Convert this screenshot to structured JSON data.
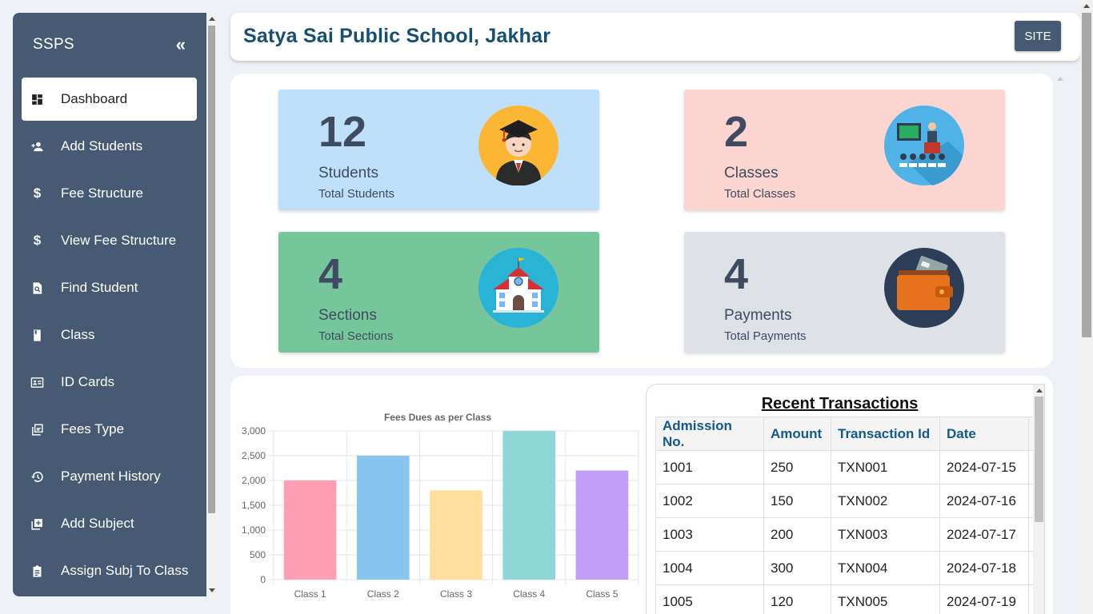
{
  "sidebar": {
    "brand": "SSPS",
    "collapse_icon": "double-chevron-left-icon",
    "items": [
      {
        "label": "Dashboard",
        "icon": "dashboard-icon",
        "active": true
      },
      {
        "label": "Add Students",
        "icon": "person-add-icon"
      },
      {
        "label": "Fee Structure",
        "icon": "dollar-icon"
      },
      {
        "label": "View Fee Structure",
        "icon": "dollar-icon"
      },
      {
        "label": "Find Student",
        "icon": "document-search-icon"
      },
      {
        "label": "Class",
        "icon": "book-icon"
      },
      {
        "label": "ID Cards",
        "icon": "id-card-icon"
      },
      {
        "label": "Fees Type",
        "icon": "library-add-icon"
      },
      {
        "label": "Payment History",
        "icon": "history-icon"
      },
      {
        "label": "Add Subject",
        "icon": "add-box-icon"
      },
      {
        "label": "Assign Subj To Class",
        "icon": "clipboard-icon"
      }
    ]
  },
  "header": {
    "school_name": "Satya Sai Public School, Jakhar",
    "site_label": "SITE"
  },
  "stats": [
    {
      "value": "12",
      "label": "Students",
      "sub": "Total Students",
      "icon": "graduate-icon",
      "color": "#bfe0fa"
    },
    {
      "value": "2",
      "label": "Classes",
      "sub": "Total Classes",
      "icon": "classroom-icon",
      "color": "#fcd5d0"
    },
    {
      "value": "4",
      "label": "Sections",
      "sub": "Total Sections",
      "icon": "school-building-icon",
      "color": "#76c69b"
    },
    {
      "value": "4",
      "label": "Payments",
      "sub": "Total Payments",
      "icon": "wallet-icon",
      "color": "#dee1e5"
    }
  ],
  "chart_data": {
    "type": "bar",
    "title": "Fees Dues as per Class",
    "categories": [
      "Class 1",
      "Class 2",
      "Class 3",
      "Class 4",
      "Class 5"
    ],
    "values": [
      2000,
      2500,
      1800,
      3000,
      2200
    ],
    "colors": [
      "#ff9fb3",
      "#89c5f1",
      "#ffdf9b",
      "#8fd7d7",
      "#bf9df9"
    ],
    "borders": [
      "#ff6384",
      "#36a2eb",
      "#ffce56",
      "#4bc0c0",
      "#9966ff"
    ],
    "yticks": [
      "0",
      "500",
      "1,000",
      "1,500",
      "2,000",
      "2,500",
      "3,000"
    ],
    "ylim": [
      0,
      3000
    ],
    "xlabel": "",
    "ylabel": "",
    "grid": true
  },
  "transactions": {
    "title": "Recent Transactions",
    "headers": [
      "Admission No.",
      "Amount",
      "Transaction Id",
      "Date"
    ],
    "rows": [
      [
        "1001",
        "250",
        "TXN001",
        "2024-07-15"
      ],
      [
        "1002",
        "150",
        "TXN002",
        "2024-07-16"
      ],
      [
        "1003",
        "200",
        "TXN003",
        "2024-07-17"
      ],
      [
        "1004",
        "300",
        "TXN004",
        "2024-07-18"
      ],
      [
        "1005",
        "120",
        "TXN005",
        "2024-07-19"
      ]
    ]
  }
}
